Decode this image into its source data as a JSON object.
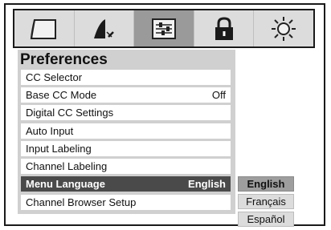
{
  "tabs": [
    {
      "icon": "picture-icon",
      "active": false
    },
    {
      "icon": "sound-icon",
      "active": false
    },
    {
      "icon": "settings-sliders-icon",
      "active": true
    },
    {
      "icon": "lock-icon",
      "active": false
    },
    {
      "icon": "brightness-sun-icon",
      "active": false
    }
  ],
  "panel": {
    "title": "Preferences",
    "items": [
      {
        "label": "CC Selector",
        "value": ""
      },
      {
        "label": "Base CC Mode",
        "value": "Off"
      },
      {
        "label": "Digital CC Settings",
        "value": ""
      },
      {
        "label": "Auto Input",
        "value": ""
      },
      {
        "label": "Input Labeling",
        "value": ""
      },
      {
        "label": "Channel Labeling",
        "value": ""
      },
      {
        "label": "Menu Language",
        "value": "English",
        "selected": true
      },
      {
        "label": "Channel Browser Setup",
        "value": ""
      }
    ]
  },
  "language_options": [
    {
      "label": "English",
      "selected": true
    },
    {
      "label": "Français",
      "selected": false
    },
    {
      "label": "Español",
      "selected": false
    }
  ],
  "colors": {
    "selected_row": "#4a4a4a",
    "panel_bg": "#d0d0d0",
    "active_tab": "#9a9a9a"
  }
}
